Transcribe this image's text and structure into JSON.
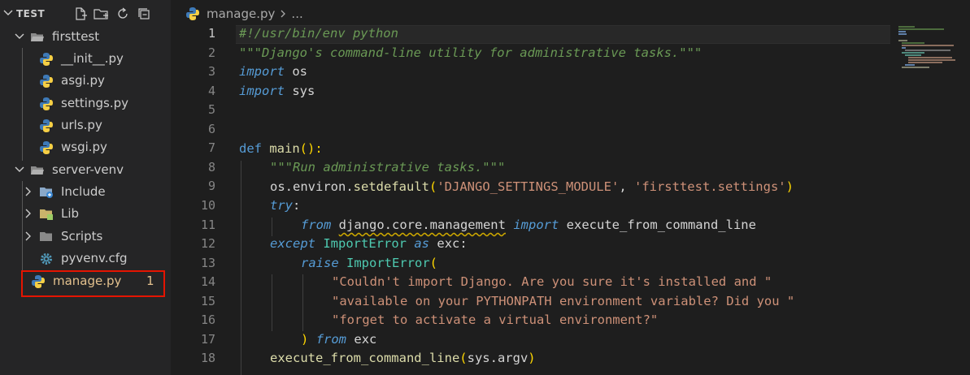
{
  "explorer": {
    "title": "TEST",
    "actions": [
      "new-file-icon",
      "new-folder-icon",
      "refresh-icon",
      "collapse-all-icon"
    ],
    "tree": [
      {
        "label": "firsttest",
        "kind": "folder",
        "expanded": true
      },
      {
        "label": "__init__.py",
        "kind": "python"
      },
      {
        "label": "asgi.py",
        "kind": "python"
      },
      {
        "label": "settings.py",
        "kind": "python"
      },
      {
        "label": "urls.py",
        "kind": "python"
      },
      {
        "label": "wsgi.py",
        "kind": "python"
      },
      {
        "label": "server-venv",
        "kind": "folder",
        "expanded": true
      },
      {
        "label": "Include",
        "kind": "folder-include",
        "expanded": false
      },
      {
        "label": "Lib",
        "kind": "folder-lib",
        "expanded": false
      },
      {
        "label": "Scripts",
        "kind": "folder",
        "expanded": false
      },
      {
        "label": "pyvenv.cfg",
        "kind": "config"
      },
      {
        "label": "manage.py",
        "kind": "python",
        "badge": "1",
        "highlighted": true
      }
    ]
  },
  "editor": {
    "breadcrumb_file": "manage.py",
    "breadcrumb_rest": "...",
    "active_line": 1,
    "line_numbers": [
      "1",
      "2",
      "3",
      "4",
      "5",
      "6",
      "7",
      "8",
      "9",
      "10",
      "11",
      "12",
      "13",
      "14",
      "15",
      "16",
      "17",
      "18"
    ],
    "code": {
      "l1": "#!/usr/bin/env python",
      "l2": "\"\"\"Django's command-line utility for administrative tasks.\"\"\"",
      "l3_kw": "import",
      "l3_mod": "os",
      "l4_kw": "import",
      "l4_mod": "sys",
      "l7_kw": "def",
      "l7_fn": "main",
      "l7_p": "():",
      "l8": "\"\"\"Run administrative tasks.\"\"\"",
      "l9_a": "os",
      "l9_b": ".environ.",
      "l9_fn": "setdefault",
      "l9_open": "(",
      "l9_s1": "'DJANGO_SETTINGS_MODULE'",
      "l9_c": ", ",
      "l9_s2": "'firsttest.settings'",
      "l9_close": ")",
      "l10_kw": "try",
      "l10_p": ":",
      "l11_kw": "from",
      "l11_mod": "django.core.management",
      "l11_kw2": "import",
      "l11_name": "execute_from_command_line",
      "l12_kw": "except",
      "l12_cls": "ImportError",
      "l12_kw2": "as",
      "l12_var": "exc",
      "l12_p": ":",
      "l13_kw": "raise",
      "l13_cls": "ImportError",
      "l13_open": "(",
      "l14": "\"Couldn't import Django. Are you sure it's installed and \"",
      "l15": "\"available on your PYTHONPATH environment variable? Did you \"",
      "l16": "\"forget to activate a virtual environment?\"",
      "l17_close": ")",
      "l17_kw": "from",
      "l17_var": "exc",
      "l18_fn": "execute_from_command_line",
      "l18_open": "(",
      "l18_arg": "sys.argv",
      "l18_close": ")"
    }
  },
  "colors": {
    "accent_highlight": "#e51400",
    "modified_badge": "#e2c08d"
  }
}
